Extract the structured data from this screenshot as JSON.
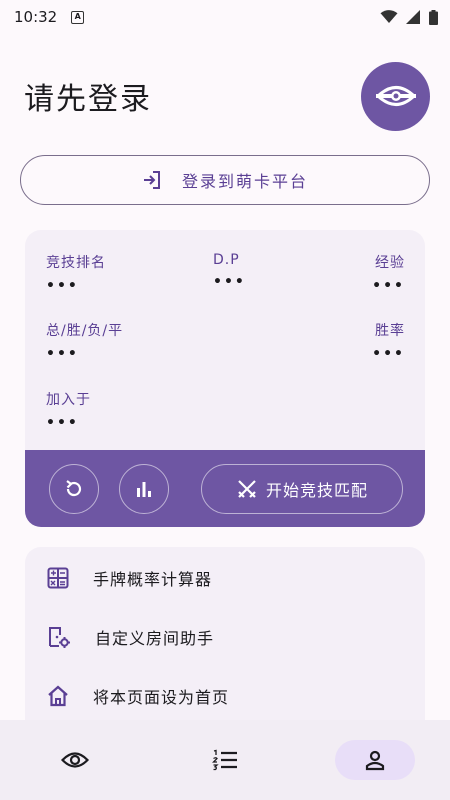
{
  "status": {
    "time": "10:32",
    "notification_icon": "a-box-icon"
  },
  "header": {
    "title": "请先登录"
  },
  "login": {
    "label": "登录到萌卡平台"
  },
  "stats": {
    "rank_label": "竞技排名",
    "rank_value": "•••",
    "dp_label": "D.P",
    "dp_value": "•••",
    "exp_label": "经验",
    "exp_value": "•••",
    "record_label": "总/胜/负/平",
    "record_value": "•••",
    "winrate_label": "胜率",
    "winrate_value": "•••",
    "joined_label": "加入于",
    "joined_value": "•••"
  },
  "actions": {
    "match_label": "开始竞技匹配"
  },
  "tools": [
    {
      "label": "手牌概率计算器",
      "icon": "calculator-icon"
    },
    {
      "label": "自定义房间助手",
      "icon": "room-settings-icon"
    },
    {
      "label": "将本页面设为首页",
      "icon": "home-icon"
    }
  ],
  "nav": [
    {
      "icon": "eye-icon",
      "active": false
    },
    {
      "icon": "list-icon",
      "active": false
    },
    {
      "icon": "person-icon",
      "active": true
    }
  ],
  "colors": {
    "accent": "#6e56a3",
    "accent_text": "#5a3f94",
    "card": "#f4eff7"
  }
}
